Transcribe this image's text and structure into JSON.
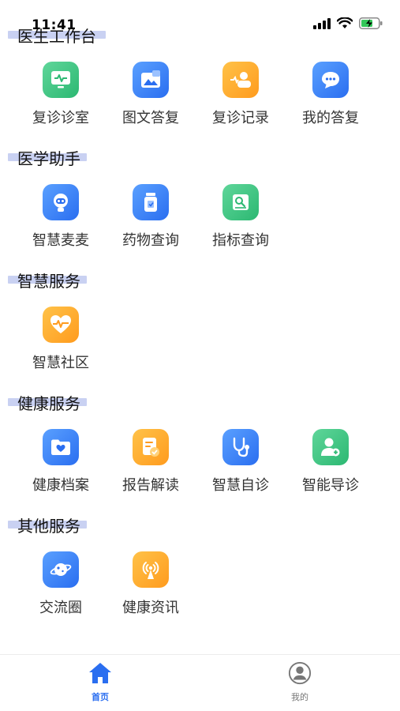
{
  "status_bar": {
    "time": "11:41"
  },
  "sections": [
    {
      "title": "医生工作台",
      "items": [
        {
          "label": "复诊诊室",
          "icon": "monitor-pulse-icon",
          "color": "green"
        },
        {
          "label": "图文答复",
          "icon": "image-text-icon",
          "color": "blue"
        },
        {
          "label": "复诊记录",
          "icon": "consult-record-icon",
          "color": "orange"
        },
        {
          "label": "我的答复",
          "icon": "chat-bubble-icon",
          "color": "blue"
        }
      ]
    },
    {
      "title": "医学助手",
      "items": [
        {
          "label": "智慧麦麦",
          "icon": "robot-icon",
          "color": "blue"
        },
        {
          "label": "药物查询",
          "icon": "medicine-bottle-icon",
          "color": "blue"
        },
        {
          "label": "指标查询",
          "icon": "indicator-search-icon",
          "color": "green"
        }
      ]
    },
    {
      "title": "智慧服务",
      "items": [
        {
          "label": "智慧社区",
          "icon": "heart-pulse-icon",
          "color": "orange"
        }
      ]
    },
    {
      "title": "健康服务",
      "items": [
        {
          "label": "健康档案",
          "icon": "health-folder-icon",
          "color": "blue"
        },
        {
          "label": "报告解读",
          "icon": "report-icon",
          "color": "orange"
        },
        {
          "label": "智慧自诊",
          "icon": "stethoscope-icon",
          "color": "blue"
        },
        {
          "label": "智能导诊",
          "icon": "user-plus-icon",
          "color": "green"
        }
      ]
    },
    {
      "title": "其他服务",
      "items": [
        {
          "label": "交流圈",
          "icon": "planet-icon",
          "color": "blue"
        },
        {
          "label": "健康资讯",
          "icon": "broadcast-icon",
          "color": "orange"
        }
      ]
    }
  ],
  "tabbar": {
    "home": "首页",
    "mine": "我的"
  }
}
